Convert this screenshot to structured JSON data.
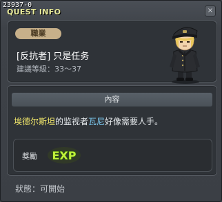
{
  "window": {
    "quest_id": "23937-0",
    "title": "QUEST INFO",
    "close_glyph": "×"
  },
  "info": {
    "job_badge": "職業",
    "job_name": "[反抗者] 只是任务",
    "recommended_level": "建議等級：33～37"
  },
  "content": {
    "header": "內容",
    "description_parts": {
      "name1": "埃德尔斯坦",
      "text1": "的监视者",
      "name2": "瓦尼",
      "text2": "好像需要人手。"
    },
    "reward_label": "獎勵",
    "reward_icon_text": "EXP"
  },
  "status": {
    "text": "狀態：可開始"
  },
  "colors": {
    "highlight_place": "#f0e66a",
    "highlight_npc": "#7cc9f0",
    "exp_icon_fill": "#bff03a",
    "badge": "#c7b08a"
  },
  "icons": {
    "portrait": "npc-officer-portrait",
    "exp": "exp-reward-icon",
    "close": "close-icon"
  }
}
